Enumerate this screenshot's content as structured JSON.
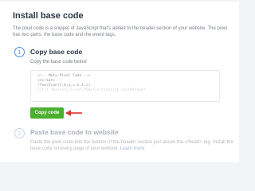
{
  "page": {
    "title": "Install base code",
    "intro": "The pixel code is a snippet of JavaScript that's added to the header section of your website. The pixel has two parts: the base code and the event tags."
  },
  "step1": {
    "number": "1",
    "title": "Copy base code",
    "subtitle": "Copy the base code below",
    "code_lines": [
      "<!-- Meta Pixel Code -->",
      "<script>",
      "!function(f,b,e,v,n,t,s)",
      "{if(f.fbq)return;n=f.fbq=function(){n.callMethod?"
    ],
    "button_label": "Copy code"
  },
  "step2": {
    "number": "2",
    "title": "Paste base code to website",
    "description": "Paste the pixel code into the bottom of the header section just above the </head> tag. Install the base code on every page of your website.",
    "link_text": "Learn more"
  },
  "colors": {
    "accent": "#4a90e2",
    "button": "#4caf2f",
    "arrow": "#e0312d"
  }
}
